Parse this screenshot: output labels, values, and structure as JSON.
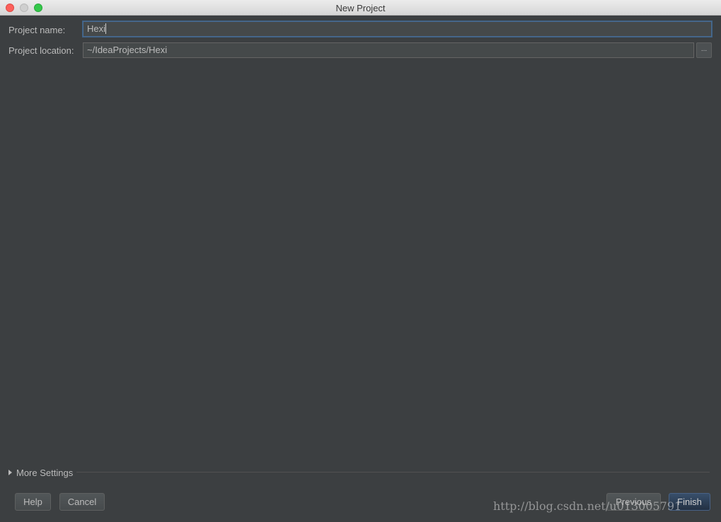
{
  "window": {
    "title": "New Project"
  },
  "form": {
    "project_name": {
      "label": "Project name:",
      "value": "Hexi"
    },
    "project_location": {
      "label": "Project location:",
      "value": "~/IdeaProjects/Hexi",
      "browse_label": "..."
    }
  },
  "more_settings": {
    "label": "More Settings",
    "icon": "disclosure-triangle-right"
  },
  "footer": {
    "help_label": "Help",
    "cancel_label": "Cancel",
    "previous_label": "Previous",
    "finish_label": "Finish"
  },
  "watermark": {
    "text": "http://blog.csdn.net/u013005791"
  },
  "colors": {
    "background": "#3c3f41",
    "field_bg": "#45494a",
    "text": "#bbbbbb",
    "focus_border": "#4a6a8f",
    "primary_button": "#2e4058"
  }
}
